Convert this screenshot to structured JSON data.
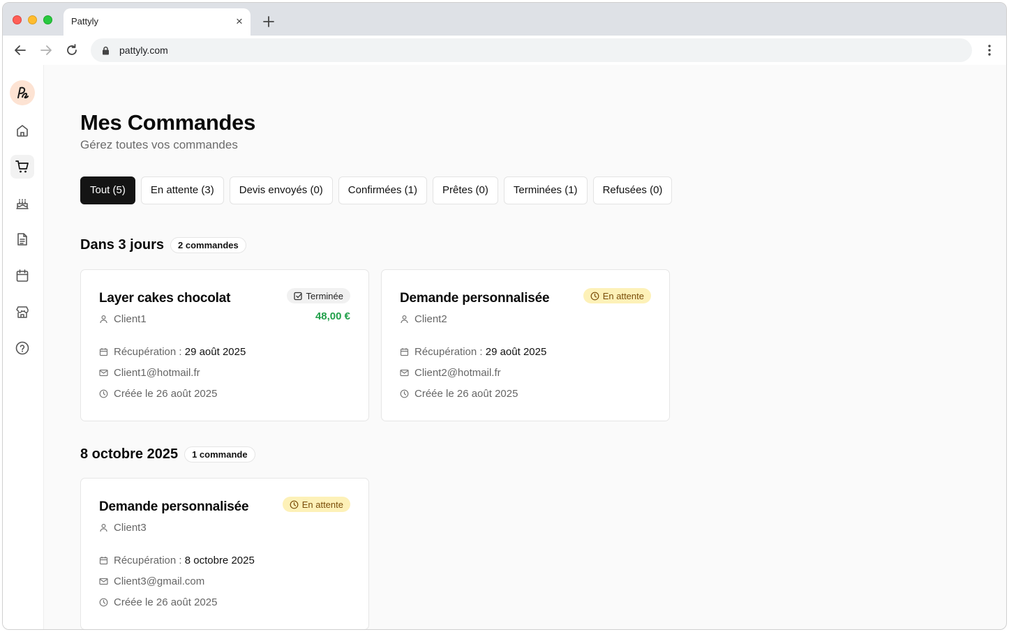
{
  "browser": {
    "tab_title": "Pattyly",
    "tab_close": "×",
    "url": "pattyly.com"
  },
  "sidebar": {
    "items": [
      {
        "name": "home",
        "icon": "home-icon"
      },
      {
        "name": "orders",
        "icon": "cart-icon",
        "active": true
      },
      {
        "name": "cakes",
        "icon": "cake-icon"
      },
      {
        "name": "documents",
        "icon": "document-icon"
      },
      {
        "name": "calendar",
        "icon": "calendar-icon"
      },
      {
        "name": "shop",
        "icon": "store-icon"
      },
      {
        "name": "help",
        "icon": "help-icon"
      }
    ]
  },
  "page": {
    "title": "Mes Commandes",
    "subtitle": "Gérez toutes vos commandes"
  },
  "filters": [
    {
      "label": "Tout (5)",
      "active": true
    },
    {
      "label": "En attente (3)"
    },
    {
      "label": "Devis envoyés (0)"
    },
    {
      "label": "Confirmées (1)"
    },
    {
      "label": "Prêtes (0)"
    },
    {
      "label": "Terminées (1)"
    },
    {
      "label": "Refusées (0)"
    }
  ],
  "groups": [
    {
      "title": "Dans 3 jours",
      "count": "2 commandes",
      "orders": [
        {
          "title": "Layer cakes chocolat",
          "status": "Terminée",
          "status_icon": "check-square-icon",
          "price": "48,00 €",
          "client": "Client1",
          "pickup_label": "Récupération :",
          "pickup_date": "29 août 2025",
          "email": "Client1@hotmail.fr",
          "created": "Créée le 26 août 2025"
        },
        {
          "title": "Demande personnalisée",
          "status": "En attente",
          "status_icon": "clock-icon",
          "price": "",
          "client": "Client2",
          "pickup_label": "Récupération :",
          "pickup_date": "29 août 2025",
          "email": "Client2@hotmail.fr",
          "created": "Créée le 26 août 2025"
        }
      ]
    },
    {
      "title": "8 octobre 2025",
      "count": "1 commande",
      "orders": [
        {
          "title": "Demande personnalisée",
          "status": "En attente",
          "status_icon": "clock-icon",
          "price": "",
          "client": "Client3",
          "pickup_label": "Récupération :",
          "pickup_date": "8 octobre 2025",
          "email": "Client3@gmail.com",
          "created": "Créée le 26 août 2025"
        }
      ]
    }
  ],
  "colors": {
    "accent_active": "#141414",
    "price_green": "#22a04b",
    "pending_bg": "#fdf1b8",
    "pending_text": "#7a4d08",
    "logo_bg": "#fde3d3"
  }
}
